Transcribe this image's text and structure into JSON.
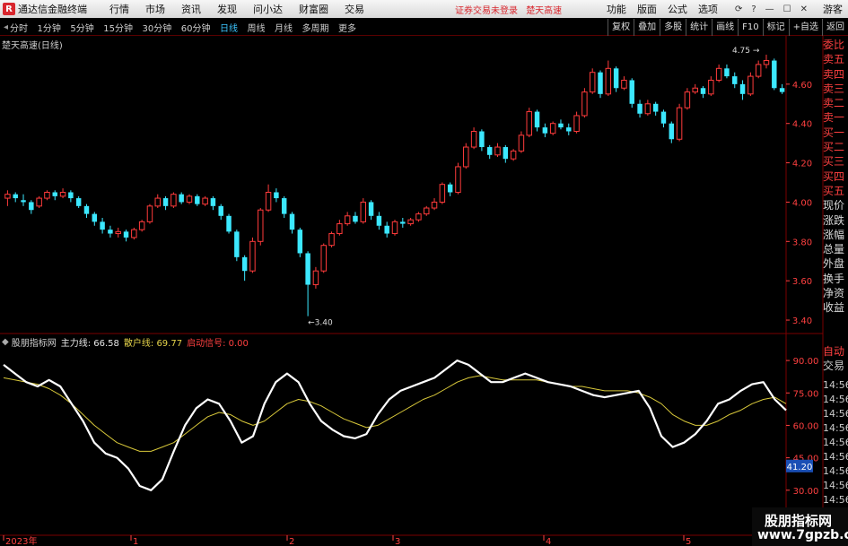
{
  "app": {
    "title": "通达信金融终端",
    "menu": [
      "行情",
      "市场",
      "资讯",
      "发现",
      "问小达",
      "财富圈",
      "交易"
    ],
    "notice": [
      "证券交易未登录",
      "楚天高速"
    ],
    "right_menu": [
      "功能",
      "版面",
      "公式",
      "选项"
    ],
    "guest": "游客"
  },
  "toolbar": {
    "periods": [
      "分时",
      "1分钟",
      "5分钟",
      "15分钟",
      "30分钟",
      "60分钟",
      "日线",
      "周线",
      "月线",
      "多周期",
      "更多"
    ],
    "active": "日线",
    "tools": [
      "复权",
      "叠加",
      "多股",
      "统计",
      "画线",
      "F10",
      "标记",
      "+自选",
      "返回"
    ]
  },
  "chart": {
    "title": "楚天高速(日线)",
    "y_ticks": [
      "4.60",
      "4.40",
      "4.20",
      "4.00",
      "3.80",
      "3.60",
      "3.40"
    ],
    "high_label": "4.75",
    "low_label": "3.40",
    "x_labels": [
      "2023年",
      "1",
      "2",
      "3",
      "4",
      "5"
    ]
  },
  "quote_panel": [
    "委比",
    "卖五",
    "卖四",
    "卖三",
    "卖二",
    "卖一",
    "买一",
    "买二",
    "买三",
    "买四",
    "买五",
    "现价",
    "涨跌",
    "涨幅",
    "总量",
    "外盘",
    "换手",
    "净资",
    "收益"
  ],
  "indicator": {
    "name": "股朋指标网",
    "main_label": "主力线: 66.58",
    "retail_label": "散户线: 69.77",
    "signal_label": "启动信号: 0.00",
    "y_ticks": [
      "90.00",
      "75.00",
      "60.00",
      "45.00",
      "30.00",
      "15.00"
    ],
    "cursor_value": "41.20",
    "right_labels": [
      "自动",
      "交易"
    ],
    "times": [
      "14:56",
      "14:56",
      "14:56",
      "14:56",
      "14:56",
      "14:56",
      "14:56",
      "14:56",
      "14:56"
    ]
  },
  "watermark": {
    "line1": "股朋指标网",
    "line2": "www.7gpzb.com"
  },
  "colors": {
    "up": "#ff3b3b",
    "down": "#3ce8ff",
    "main_line": "#ffffff",
    "retail_line": "#d8c83a",
    "grid_red": "#7a0000"
  },
  "chart_data": {
    "type": "candlestick",
    "ylim": [
      3.35,
      4.8
    ],
    "candles": [
      [
        4.02,
        4.04,
        4.06,
        3.98
      ],
      [
        4.04,
        4.02,
        4.05,
        4.0
      ],
      [
        4.01,
        4.0,
        4.04,
        3.98
      ],
      [
        4.0,
        3.96,
        4.01,
        3.94
      ],
      [
        3.98,
        4.02,
        4.03,
        3.97
      ],
      [
        4.02,
        4.05,
        4.06,
        4.01
      ],
      [
        4.05,
        4.03,
        4.06,
        4.01
      ],
      [
        4.03,
        4.05,
        4.07,
        4.02
      ],
      [
        4.05,
        4.02,
        4.06,
        4.0
      ],
      [
        4.02,
        3.98,
        4.03,
        3.97
      ],
      [
        3.98,
        3.94,
        3.99,
        3.92
      ],
      [
        3.94,
        3.9,
        3.95,
        3.88
      ],
      [
        3.9,
        3.86,
        3.92,
        3.84
      ],
      [
        3.86,
        3.84,
        3.88,
        3.82
      ],
      [
        3.84,
        3.85,
        3.87,
        3.82
      ],
      [
        3.85,
        3.82,
        3.86,
        3.8
      ],
      [
        3.82,
        3.86,
        3.87,
        3.81
      ],
      [
        3.86,
        3.9,
        3.91,
        3.85
      ],
      [
        3.9,
        3.98,
        3.99,
        3.89
      ],
      [
        3.98,
        4.02,
        4.04,
        3.97
      ],
      [
        4.02,
        3.98,
        4.03,
        3.96
      ],
      [
        3.98,
        4.04,
        4.05,
        3.97
      ],
      [
        4.04,
        4.0,
        4.05,
        3.99
      ],
      [
        4.0,
        4.03,
        4.04,
        3.99
      ],
      [
        4.03,
        3.99,
        4.04,
        3.98
      ],
      [
        3.99,
        4.02,
        4.03,
        3.98
      ],
      [
        4.02,
        3.98,
        4.03,
        3.96
      ],
      [
        3.98,
        3.93,
        3.99,
        3.91
      ],
      [
        3.93,
        3.85,
        3.94,
        3.84
      ],
      [
        3.85,
        3.72,
        3.86,
        3.7
      ],
      [
        3.72,
        3.65,
        3.73,
        3.6
      ],
      [
        3.65,
        3.8,
        3.82,
        3.64
      ],
      [
        3.8,
        3.96,
        3.97,
        3.78
      ],
      [
        3.96,
        4.05,
        4.09,
        3.95
      ],
      [
        4.05,
        4.02,
        4.07,
        4.0
      ],
      [
        4.02,
        3.94,
        4.03,
        3.92
      ],
      [
        3.94,
        3.86,
        3.95,
        3.84
      ],
      [
        3.86,
        3.74,
        3.87,
        3.72
      ],
      [
        3.74,
        3.58,
        3.75,
        3.42
      ],
      [
        3.58,
        3.65,
        3.67,
        3.56
      ],
      [
        3.65,
        3.78,
        3.79,
        3.64
      ],
      [
        3.78,
        3.84,
        3.85,
        3.77
      ],
      [
        3.84,
        3.89,
        3.91,
        3.83
      ],
      [
        3.89,
        3.93,
        3.95,
        3.88
      ],
      [
        3.93,
        3.9,
        3.95,
        3.89
      ],
      [
        3.9,
        4.0,
        4.02,
        3.89
      ],
      [
        4.0,
        3.93,
        4.01,
        3.91
      ],
      [
        3.93,
        3.88,
        3.95,
        3.86
      ],
      [
        3.88,
        3.84,
        3.9,
        3.82
      ],
      [
        3.84,
        3.9,
        3.91,
        3.83
      ],
      [
        3.9,
        3.89,
        3.92,
        3.87
      ],
      [
        3.89,
        3.91,
        3.92,
        3.88
      ],
      [
        3.91,
        3.94,
        3.95,
        3.9
      ],
      [
        3.94,
        3.97,
        3.98,
        3.93
      ],
      [
        3.97,
        4.0,
        4.02,
        3.96
      ],
      [
        4.0,
        4.09,
        4.1,
        3.99
      ],
      [
        4.09,
        4.05,
        4.1,
        4.03
      ],
      [
        4.05,
        4.18,
        4.2,
        4.04
      ],
      [
        4.18,
        4.28,
        4.3,
        4.17
      ],
      [
        4.28,
        4.36,
        4.38,
        4.27
      ],
      [
        4.36,
        4.28,
        4.37,
        4.26
      ],
      [
        4.28,
        4.24,
        4.29,
        4.22
      ],
      [
        4.24,
        4.28,
        4.3,
        4.23
      ],
      [
        4.28,
        4.22,
        4.29,
        4.2
      ],
      [
        4.22,
        4.26,
        4.27,
        4.21
      ],
      [
        4.26,
        4.34,
        4.36,
        4.25
      ],
      [
        4.34,
        4.46,
        4.48,
        4.33
      ],
      [
        4.46,
        4.38,
        4.47,
        4.36
      ],
      [
        4.38,
        4.35,
        4.4,
        4.33
      ],
      [
        4.35,
        4.4,
        4.41,
        4.34
      ],
      [
        4.4,
        4.38,
        4.42,
        4.37
      ],
      [
        4.38,
        4.36,
        4.4,
        4.34
      ],
      [
        4.36,
        4.44,
        4.46,
        4.35
      ],
      [
        4.44,
        4.56,
        4.58,
        4.43
      ],
      [
        4.56,
        4.66,
        4.68,
        4.55
      ],
      [
        4.66,
        4.55,
        4.67,
        4.53
      ],
      [
        4.55,
        4.68,
        4.72,
        4.54
      ],
      [
        4.68,
        4.58,
        4.69,
        4.56
      ],
      [
        4.58,
        4.62,
        4.64,
        4.57
      ],
      [
        4.62,
        4.5,
        4.63,
        4.48
      ],
      [
        4.5,
        4.45,
        4.52,
        4.43
      ],
      [
        4.45,
        4.5,
        4.52,
        4.44
      ],
      [
        4.5,
        4.46,
        4.51,
        4.44
      ],
      [
        4.46,
        4.4,
        4.47,
        4.38
      ],
      [
        4.4,
        4.32,
        4.41,
        4.3
      ],
      [
        4.32,
        4.48,
        4.5,
        4.31
      ],
      [
        4.48,
        4.56,
        4.58,
        4.47
      ],
      [
        4.56,
        4.58,
        4.6,
        4.55
      ],
      [
        4.58,
        4.55,
        4.59,
        4.53
      ],
      [
        4.55,
        4.62,
        4.64,
        4.54
      ],
      [
        4.62,
        4.68,
        4.7,
        4.61
      ],
      [
        4.68,
        4.64,
        4.7,
        4.63
      ],
      [
        4.64,
        4.6,
        4.66,
        4.58
      ],
      [
        4.6,
        4.55,
        4.62,
        4.52
      ],
      [
        4.55,
        4.64,
        4.66,
        4.54
      ],
      [
        4.64,
        4.7,
        4.72,
        4.63
      ],
      [
        4.7,
        4.72,
        4.75,
        4.68
      ],
      [
        4.72,
        4.58,
        4.73,
        4.57
      ],
      [
        4.58,
        4.56,
        4.6,
        4.55
      ]
    ],
    "indicator_ylim": [
      10,
      100
    ],
    "main_line": [
      88,
      84,
      80,
      78,
      81,
      78,
      70,
      62,
      52,
      47,
      45,
      40,
      32,
      30,
      35,
      48,
      60,
      68,
      72,
      70,
      62,
      52,
      55,
      70,
      80,
      84,
      80,
      70,
      62,
      58,
      55,
      54,
      56,
      65,
      72,
      76,
      78,
      80,
      82,
      86,
      90,
      88,
      84,
      80,
      80,
      82,
      84,
      82,
      80,
      79,
      78,
      76,
      74,
      73,
      74,
      75,
      76,
      68,
      55,
      50,
      52,
      56,
      62,
      70,
      72,
      76,
      79,
      80,
      72,
      67
    ],
    "retail_line": [
      82,
      81,
      80,
      79,
      77,
      74,
      70,
      65,
      60,
      56,
      52,
      50,
      48,
      48,
      50,
      52,
      56,
      60,
      64,
      66,
      65,
      62,
      60,
      62,
      66,
      70,
      72,
      71,
      69,
      66,
      63,
      61,
      59,
      60,
      63,
      66,
      69,
      72,
      74,
      77,
      80,
      82,
      83,
      82,
      81,
      81,
      81,
      81,
      80,
      79,
      78,
      78,
      77,
      76,
      76,
      76,
      75,
      73,
      70,
      65,
      62,
      60,
      60,
      62,
      65,
      67,
      70,
      72,
      73,
      70
    ]
  }
}
